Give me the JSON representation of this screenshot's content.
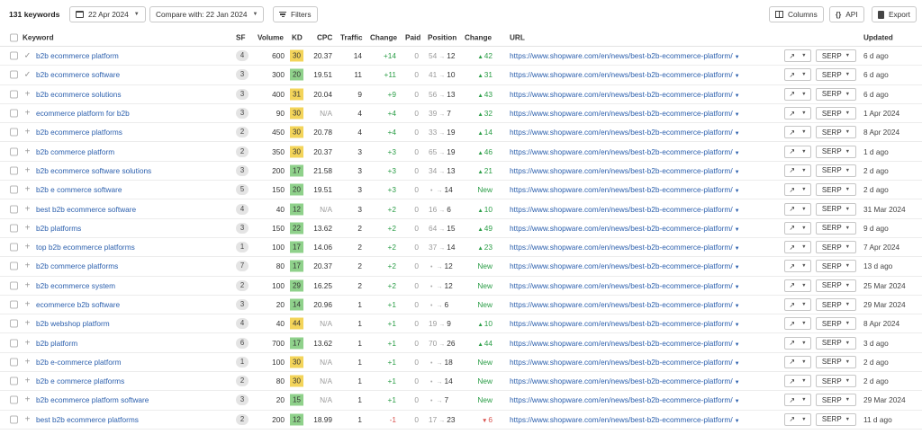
{
  "toolbar": {
    "keyword_count": "131 keywords",
    "date_label": "22 Apr 2024",
    "compare_label": "Compare with: 22 Jan 2024",
    "filters_label": "Filters",
    "columns_label": "Columns",
    "api_label": "API",
    "export_label": "Export"
  },
  "headers": {
    "keyword": "Keyword",
    "sf": "SF",
    "volume": "Volume",
    "kd": "KD",
    "cpc": "CPC",
    "traffic": "Traffic",
    "change": "Change",
    "paid": "Paid",
    "position": "Position",
    "pos_change": "Change",
    "url": "URL",
    "updated": "Updated"
  },
  "serp_label": "SERP",
  "colors": {
    "link": "#2b5fad",
    "positive": "#2a9d46",
    "negative": "#d9534f",
    "kd_yellow": "#f3d45a",
    "kd_green": "#8fd18b"
  },
  "rows": [
    {
      "mark": "check",
      "keyword": "b2b ecommerce platform",
      "sf": "4",
      "volume": "600",
      "kd": "30",
      "kd_color": "yellow",
      "cpc": "20.37",
      "traffic": "14",
      "change": "+14",
      "change_sign": "pos",
      "paid": "0",
      "pos_from": "54",
      "pos_to": "12",
      "pos_change": "42",
      "pos_change_dir": "up",
      "url": "https://www.shopware.com/en/news/best-b2b-ecommerce-platform/",
      "updated": "6 d ago"
    },
    {
      "mark": "check",
      "keyword": "b2b ecommerce software",
      "sf": "3",
      "volume": "300",
      "kd": "20",
      "kd_color": "green",
      "cpc": "19.51",
      "traffic": "11",
      "change": "+11",
      "change_sign": "pos",
      "paid": "0",
      "pos_from": "41",
      "pos_to": "10",
      "pos_change": "31",
      "pos_change_dir": "up",
      "url": "https://www.shopware.com/en/news/best-b2b-ecommerce-platform/",
      "updated": "6 d ago"
    },
    {
      "mark": "plus",
      "keyword": "b2b ecommerce solutions",
      "sf": "3",
      "volume": "400",
      "kd": "31",
      "kd_color": "yellow",
      "cpc": "20.04",
      "traffic": "9",
      "change": "+9",
      "change_sign": "pos",
      "paid": "0",
      "pos_from": "56",
      "pos_to": "13",
      "pos_change": "43",
      "pos_change_dir": "up",
      "url": "https://www.shopware.com/en/news/best-b2b-ecommerce-platform/",
      "updated": "6 d ago"
    },
    {
      "mark": "plus",
      "keyword": "ecommerce platform for b2b",
      "sf": "3",
      "volume": "90",
      "kd": "30",
      "kd_color": "yellow",
      "cpc": "N/A",
      "traffic": "4",
      "change": "+4",
      "change_sign": "pos",
      "paid": "0",
      "pos_from": "39",
      "pos_to": "7",
      "pos_change": "32",
      "pos_change_dir": "up",
      "url": "https://www.shopware.com/en/news/best-b2b-ecommerce-platform/",
      "updated": "1 Apr 2024"
    },
    {
      "mark": "plus",
      "keyword": "b2b ecommerce platforms",
      "sf": "2",
      "volume": "450",
      "kd": "30",
      "kd_color": "yellow",
      "cpc": "20.78",
      "traffic": "4",
      "change": "+4",
      "change_sign": "pos",
      "paid": "0",
      "pos_from": "33",
      "pos_to": "19",
      "pos_change": "14",
      "pos_change_dir": "up",
      "url": "https://www.shopware.com/en/news/best-b2b-ecommerce-platform/",
      "updated": "8 Apr 2024"
    },
    {
      "mark": "plus",
      "keyword": "b2b commerce platform",
      "sf": "2",
      "volume": "350",
      "kd": "30",
      "kd_color": "yellow",
      "cpc": "20.37",
      "traffic": "3",
      "change": "+3",
      "change_sign": "pos",
      "paid": "0",
      "pos_from": "65",
      "pos_to": "19",
      "pos_change": "46",
      "pos_change_dir": "up",
      "url": "https://www.shopware.com/en/news/best-b2b-ecommerce-platform/",
      "updated": "1 d ago"
    },
    {
      "mark": "plus",
      "keyword": "b2b ecommerce software solutions",
      "sf": "3",
      "volume": "200",
      "kd": "17",
      "kd_color": "green",
      "cpc": "21.58",
      "traffic": "3",
      "change": "+3",
      "change_sign": "pos",
      "paid": "0",
      "pos_from": "34",
      "pos_to": "13",
      "pos_change": "21",
      "pos_change_dir": "up",
      "url": "https://www.shopware.com/en/news/best-b2b-ecommerce-platform/",
      "updated": "2 d ago"
    },
    {
      "mark": "plus",
      "keyword": "b2b e commerce software",
      "sf": "5",
      "volume": "150",
      "kd": "20",
      "kd_color": "green",
      "cpc": "19.51",
      "traffic": "3",
      "change": "+3",
      "change_sign": "pos",
      "paid": "0",
      "pos_from": "",
      "pos_to": "14",
      "pos_change": "New",
      "pos_change_dir": "new",
      "url": "https://www.shopware.com/en/news/best-b2b-ecommerce-platform/",
      "updated": "2 d ago"
    },
    {
      "mark": "plus",
      "keyword": "best b2b ecommerce software",
      "sf": "4",
      "volume": "40",
      "kd": "12",
      "kd_color": "green",
      "cpc": "N/A",
      "traffic": "3",
      "change": "+2",
      "change_sign": "pos",
      "paid": "0",
      "pos_from": "16",
      "pos_to": "6",
      "pos_change": "10",
      "pos_change_dir": "up",
      "url": "https://www.shopware.com/en/news/best-b2b-ecommerce-platform/",
      "updated": "31 Mar 2024"
    },
    {
      "mark": "plus",
      "keyword": "b2b platforms",
      "sf": "3",
      "volume": "150",
      "kd": "22",
      "kd_color": "green",
      "cpc": "13.62",
      "traffic": "2",
      "change": "+2",
      "change_sign": "pos",
      "paid": "0",
      "pos_from": "64",
      "pos_to": "15",
      "pos_change": "49",
      "pos_change_dir": "up",
      "url": "https://www.shopware.com/en/news/best-b2b-ecommerce-platform/",
      "updated": "9 d ago"
    },
    {
      "mark": "plus",
      "keyword": "top b2b ecommerce platforms",
      "sf": "1",
      "volume": "100",
      "kd": "17",
      "kd_color": "green",
      "cpc": "14.06",
      "traffic": "2",
      "change": "+2",
      "change_sign": "pos",
      "paid": "0",
      "pos_from": "37",
      "pos_to": "14",
      "pos_change": "23",
      "pos_change_dir": "up",
      "url": "https://www.shopware.com/en/news/best-b2b-ecommerce-platform/",
      "updated": "7 Apr 2024"
    },
    {
      "mark": "plus",
      "keyword": "b2b commerce platforms",
      "sf": "7",
      "volume": "80",
      "kd": "17",
      "kd_color": "green",
      "cpc": "20.37",
      "traffic": "2",
      "change": "+2",
      "change_sign": "pos",
      "paid": "0",
      "pos_from": "",
      "pos_to": "12",
      "pos_change": "New",
      "pos_change_dir": "new",
      "url": "https://www.shopware.com/en/news/best-b2b-ecommerce-platform/",
      "updated": "13 d ago"
    },
    {
      "mark": "plus",
      "keyword": "b2b ecommerce system",
      "sf": "2",
      "volume": "100",
      "kd": "29",
      "kd_color": "green",
      "cpc": "16.25",
      "traffic": "2",
      "change": "+2",
      "change_sign": "pos",
      "paid": "0",
      "pos_from": "",
      "pos_to": "12",
      "pos_change": "New",
      "pos_change_dir": "new",
      "url": "https://www.shopware.com/en/news/best-b2b-ecommerce-platform/",
      "updated": "25 Mar 2024"
    },
    {
      "mark": "plus",
      "keyword": "ecommerce b2b software",
      "sf": "3",
      "volume": "20",
      "kd": "14",
      "kd_color": "green",
      "cpc": "20.96",
      "traffic": "1",
      "change": "+1",
      "change_sign": "pos",
      "paid": "0",
      "pos_from": "",
      "pos_to": "6",
      "pos_change": "New",
      "pos_change_dir": "new",
      "url": "https://www.shopware.com/en/news/best-b2b-ecommerce-platform/",
      "updated": "29 Mar 2024"
    },
    {
      "mark": "plus",
      "keyword": "b2b webshop platform",
      "sf": "4",
      "volume": "40",
      "kd": "44",
      "kd_color": "yellow",
      "cpc": "N/A",
      "traffic": "1",
      "change": "+1",
      "change_sign": "pos",
      "paid": "0",
      "pos_from": "19",
      "pos_to": "9",
      "pos_change": "10",
      "pos_change_dir": "up",
      "url": "https://www.shopware.com/en/news/best-b2b-ecommerce-platform/",
      "updated": "8 Apr 2024"
    },
    {
      "mark": "plus",
      "keyword": "b2b platform",
      "sf": "6",
      "volume": "700",
      "kd": "17",
      "kd_color": "green",
      "cpc": "13.62",
      "traffic": "1",
      "change": "+1",
      "change_sign": "pos",
      "paid": "0",
      "pos_from": "70",
      "pos_to": "26",
      "pos_change": "44",
      "pos_change_dir": "up",
      "url": "https://www.shopware.com/en/news/best-b2b-ecommerce-platform/",
      "updated": "3 d ago"
    },
    {
      "mark": "plus",
      "keyword": "b2b e-commerce platform",
      "sf": "1",
      "volume": "100",
      "kd": "30",
      "kd_color": "yellow",
      "cpc": "N/A",
      "traffic": "1",
      "change": "+1",
      "change_sign": "pos",
      "paid": "0",
      "pos_from": "",
      "pos_to": "18",
      "pos_change": "New",
      "pos_change_dir": "new",
      "url": "https://www.shopware.com/en/news/best-b2b-ecommerce-platform/",
      "updated": "2 d ago"
    },
    {
      "mark": "plus",
      "keyword": "b2b e commerce platforms",
      "sf": "2",
      "volume": "80",
      "kd": "30",
      "kd_color": "yellow",
      "cpc": "N/A",
      "traffic": "1",
      "change": "+1",
      "change_sign": "pos",
      "paid": "0",
      "pos_from": "",
      "pos_to": "14",
      "pos_change": "New",
      "pos_change_dir": "new",
      "url": "https://www.shopware.com/en/news/best-b2b-ecommerce-platform/",
      "updated": "2 d ago"
    },
    {
      "mark": "plus",
      "keyword": "b2b ecommerce platform software",
      "sf": "3",
      "volume": "20",
      "kd": "15",
      "kd_color": "green",
      "cpc": "N/A",
      "traffic": "1",
      "change": "+1",
      "change_sign": "pos",
      "paid": "0",
      "pos_from": "",
      "pos_to": "7",
      "pos_change": "New",
      "pos_change_dir": "new",
      "url": "https://www.shopware.com/en/news/best-b2b-ecommerce-platform/",
      "updated": "29 Mar 2024"
    },
    {
      "mark": "plus",
      "keyword": "best b2b ecommerce platforms",
      "sf": "2",
      "volume": "200",
      "kd": "12",
      "kd_color": "green",
      "cpc": "18.99",
      "traffic": "1",
      "change": "-1",
      "change_sign": "neg",
      "paid": "0",
      "pos_from": "17",
      "pos_to": "23",
      "pos_change": "6",
      "pos_change_dir": "down",
      "url": "https://www.shopware.com/en/news/best-b2b-ecommerce-platform/",
      "updated": "11 d ago"
    }
  ]
}
